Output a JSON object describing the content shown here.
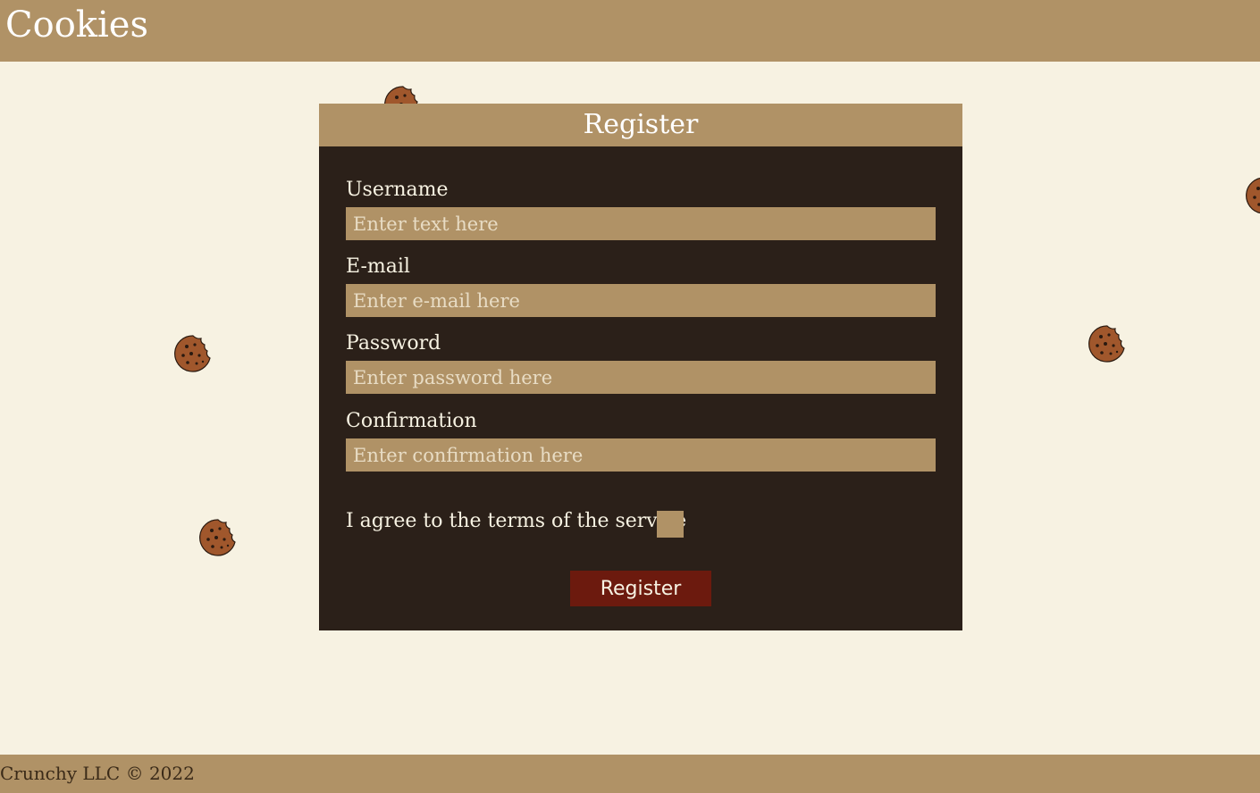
{
  "header": {
    "title": "Cookies"
  },
  "form": {
    "title": "Register",
    "fields": [
      {
        "label": "Username",
        "placeholder": "Enter text here"
      },
      {
        "label": "E-mail",
        "placeholder": "Enter e-mail here"
      },
      {
        "label": "Password",
        "placeholder": "Enter password here"
      },
      {
        "label": "Confirmation",
        "placeholder": "Enter confirmation here"
      }
    ],
    "agree_label": "I agree to the terms of the service",
    "submit_label": "Register"
  },
  "footer": {
    "text": "Crunchy LLC © 2022"
  },
  "colors": {
    "header_bg": "#b09266",
    "page_bg": "#f7f2e2",
    "card_bg": "#2b2019",
    "button_bg": "#6c1a0e"
  },
  "decorations": {
    "cookie_icon": "cookie-icon"
  }
}
